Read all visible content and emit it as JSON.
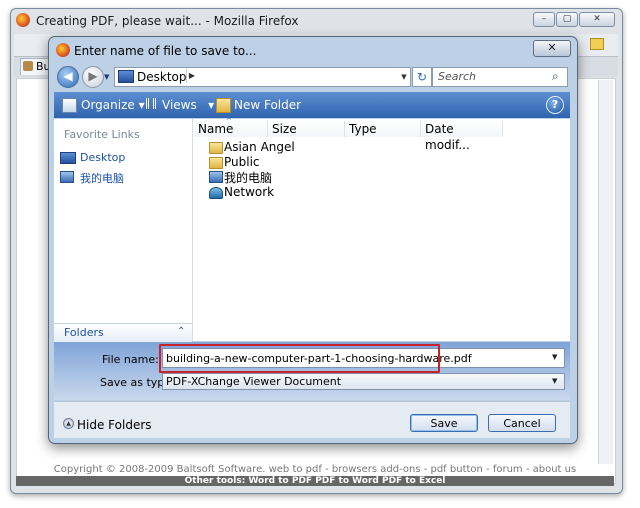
{
  "browser": {
    "title": "Creating PDF, please wait... - Mozilla Firefox",
    "tab_label": "Bu",
    "footer_copyright": "Copyright © 2008-2009 Baltsoft Software.  web to pdf - browsers add-ons - pdf button - forum - about us",
    "footer_other_tools": "Other tools:    Word to PDF    PDF to Word    PDF to Excel"
  },
  "dialog": {
    "title": "Enter name of file to save to...",
    "address": {
      "location": "Desktop"
    },
    "search": {
      "placeholder": "Search"
    },
    "toolbar": {
      "organize": "Organize",
      "views": "Views",
      "new_folder": "New Folder"
    },
    "nav": {
      "favorite_links_label": "Favorite Links",
      "links": [
        "Desktop",
        "我的电脑"
      ],
      "folders_label": "Folders"
    },
    "columns": [
      "Name",
      "Size",
      "Type",
      "Date modif..."
    ],
    "files": [
      {
        "name": "Asian Angel",
        "icon": "folder-icon"
      },
      {
        "name": "Public",
        "icon": "folder-icon"
      },
      {
        "name": "我的电脑",
        "icon": "computer-icon"
      },
      {
        "name": "Network",
        "icon": "network-icon"
      }
    ],
    "form": {
      "file_name_label": "File name:",
      "file_name_value": "building-a-new-computer-part-1-choosing-hardware.pdf",
      "save_as_type_label": "Save as type:",
      "save_as_type_value": "PDF-XChange Viewer Document"
    },
    "buttons": {
      "hide_folders": "Hide Folders",
      "save": "Save",
      "cancel": "Cancel"
    },
    "colors": {
      "toolbar": "#3a6fb9",
      "highlight": "#c8222c"
    }
  }
}
